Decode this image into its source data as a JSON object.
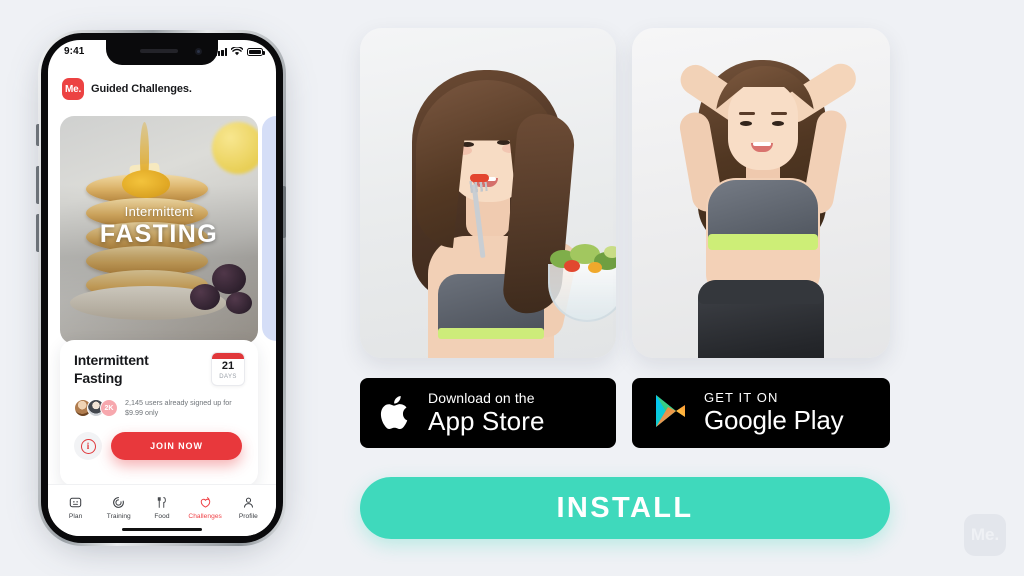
{
  "background_color": "#eff1f5",
  "phone": {
    "status_bar": {
      "time": "9:41",
      "signal_icon": "signal-bars-icon",
      "wifi_icon": "wifi-icon",
      "battery_icon": "battery-icon"
    },
    "app_header": {
      "logo_text": "Me.",
      "title": "Guided Challenges.",
      "logo_color": "#ec4242"
    },
    "hero": {
      "overline": "Intermittent",
      "title": "FASTING",
      "image_alt": "pancake-stack-photo"
    },
    "challenge_card": {
      "title": "Intermittent Fasting",
      "days_badge": {
        "number": "21",
        "label": "DAYS"
      },
      "avatar_overflow": "2K",
      "signup_text": "2,145 users already signed up for $9.99 only",
      "info_glyph": "i",
      "join_label": "JOIN NOW",
      "join_color": "#e8383c"
    },
    "tabs": [
      {
        "label": "Plan",
        "icon": "plan-icon",
        "active": false
      },
      {
        "label": "Training",
        "icon": "training-icon",
        "active": false
      },
      {
        "label": "Food",
        "icon": "food-icon",
        "active": false
      },
      {
        "label": "Challenges",
        "icon": "challenges-icon",
        "active": true
      },
      {
        "label": "Profile",
        "icon": "profile-icon",
        "active": false
      }
    ],
    "active_tab_color": "#ef4146"
  },
  "photos": [
    {
      "name": "woman-eating-salad-photo"
    },
    {
      "name": "woman-fitness-pose-photo"
    }
  ],
  "store_badges": {
    "apple": {
      "line1": "Download on the",
      "line2": "App Store",
      "icon": "apple-logo-icon"
    },
    "google": {
      "line1": "GET IT ON",
      "line2": "Google Play",
      "icon": "google-play-logo-icon"
    }
  },
  "install_button": {
    "label": "INSTALL",
    "color": "#3fd9bc"
  },
  "watermark": {
    "text": "Me."
  }
}
